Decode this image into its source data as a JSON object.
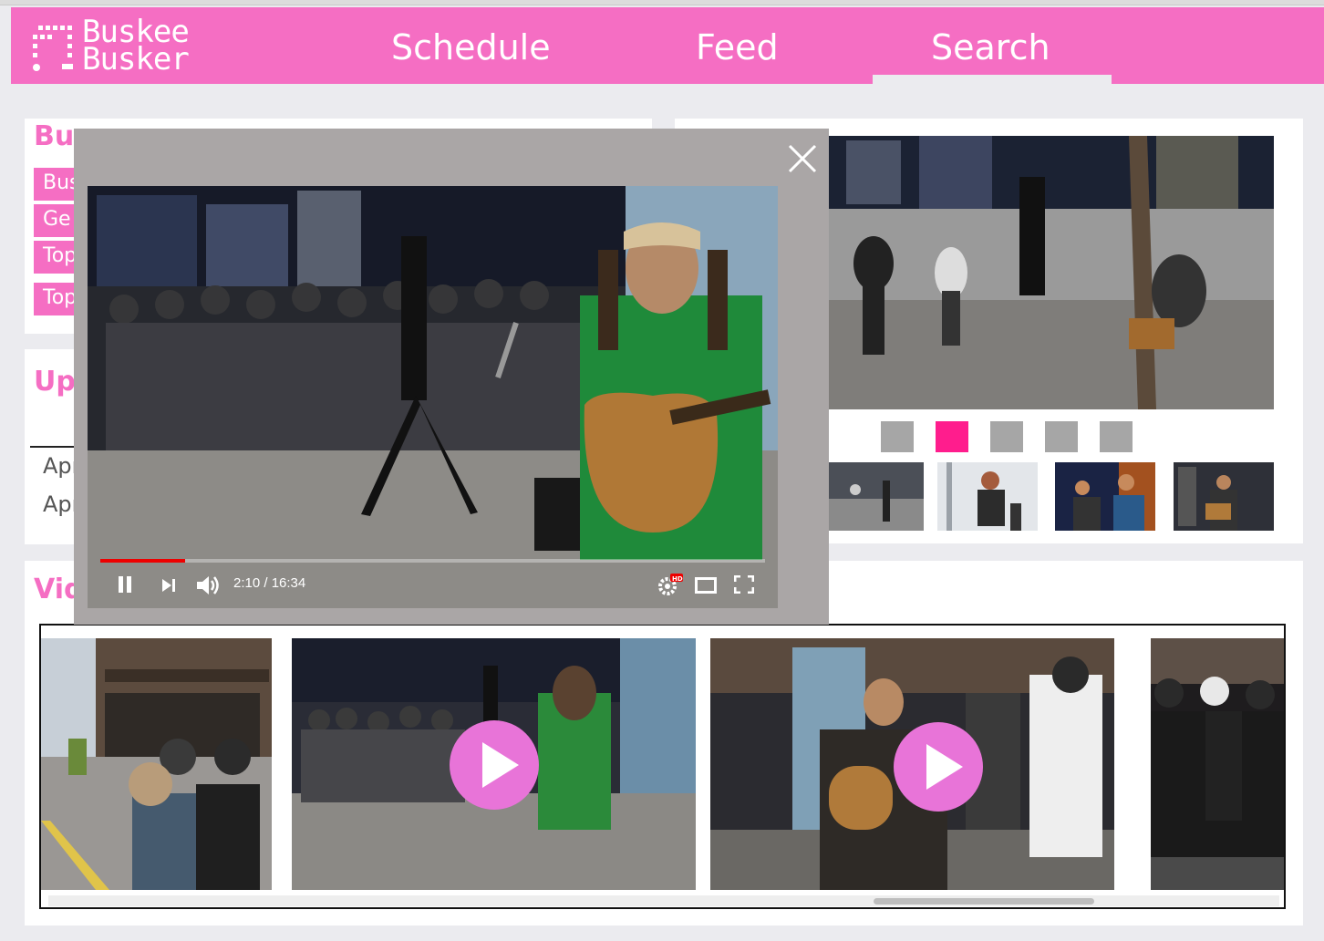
{
  "brand": {
    "line1": "Buskee",
    "line2": "Busker"
  },
  "nav": {
    "schedule": "Schedule",
    "feed": "Feed",
    "search": "Search"
  },
  "info": {
    "title_visible": "Bus",
    "pills": [
      "Bus",
      "Ge",
      "Top",
      "Top"
    ]
  },
  "upcoming": {
    "title_visible": "Upc",
    "dates": [
      "Apr",
      "Apr"
    ]
  },
  "videos": {
    "title_visible": "Vid"
  },
  "carousel": {
    "dot_count": 5,
    "active_index": 1
  },
  "player": {
    "time": "2:10 / 16:34",
    "progress_fraction": 0.128
  },
  "colors": {
    "brand_pink": "#f56ec3",
    "active_dot": "#ff1d8d",
    "play_button": "#e874d8"
  },
  "icons": [
    "close-icon",
    "pause-icon",
    "next-icon",
    "volume-icon",
    "settings-hd-icon",
    "theater-icon",
    "fullscreen-icon",
    "play-icon"
  ]
}
